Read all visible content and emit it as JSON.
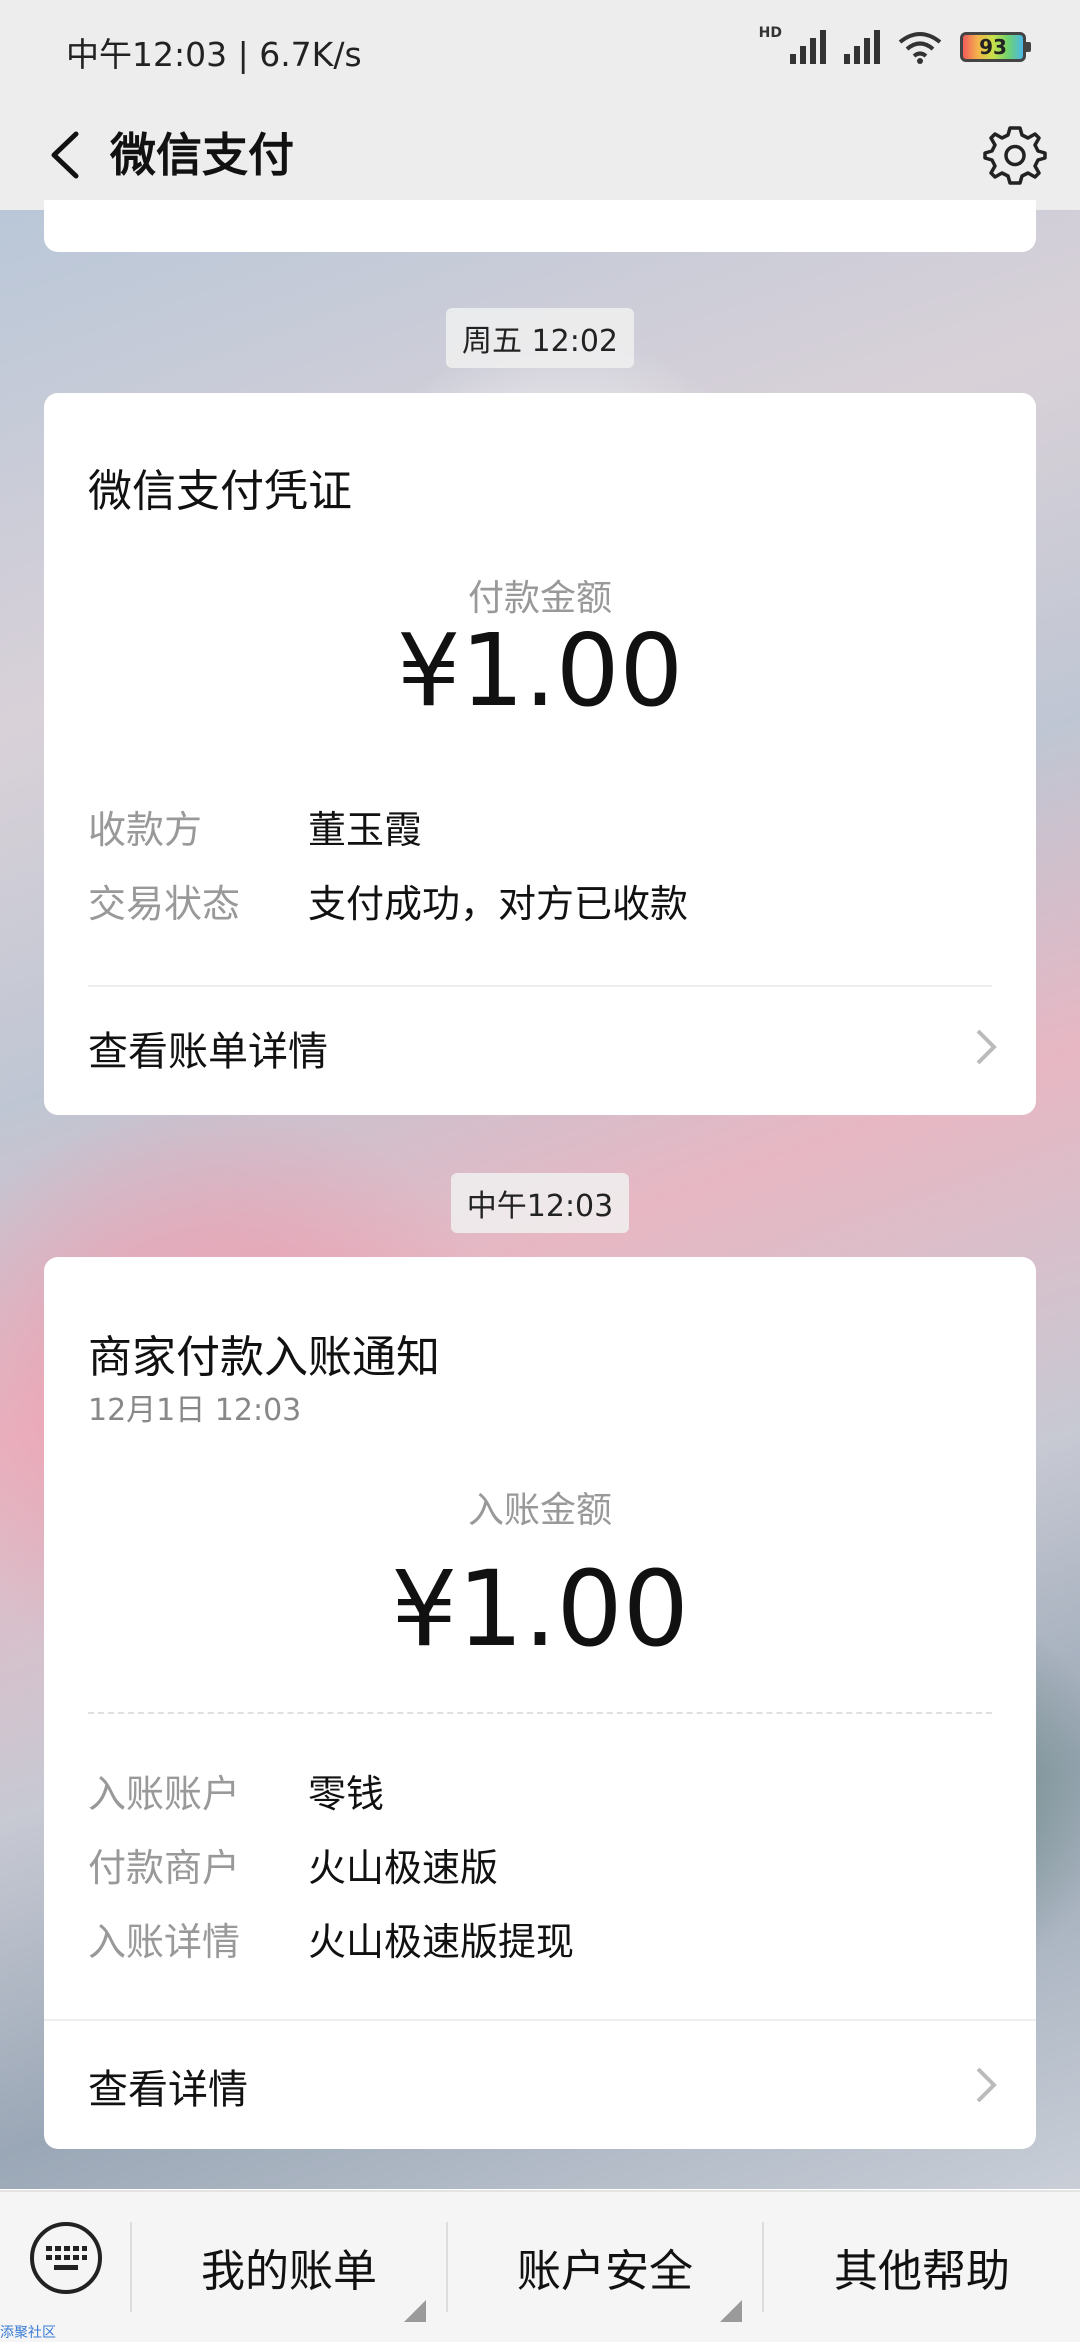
{
  "status_bar": {
    "time": "中午12:03 | 6.7K/s",
    "hd": "HD",
    "battery": "93"
  },
  "nav": {
    "title": "微信支付"
  },
  "cards": [
    {
      "timestamp": "周五 12:02",
      "title": "微信支付凭证",
      "amount_label": "付款金额",
      "amount": "¥1.00",
      "rows": [
        {
          "key": "收款方",
          "value": "董玉霞"
        },
        {
          "key": "交易状态",
          "value": "支付成功，对方已收款"
        }
      ],
      "link": "查看账单详情"
    },
    {
      "timestamp": "中午12:03",
      "title": "商家付款入账通知",
      "subtitle": "12月1日  12:03",
      "amount_label": "入账金额",
      "amount": "¥1.00",
      "rows": [
        {
          "key": "入账账户",
          "value": "零钱"
        },
        {
          "key": "付款商户",
          "value": "火山极速版"
        },
        {
          "key": "入账详情",
          "value": "火山极速版提现"
        }
      ],
      "link": "查看详情"
    }
  ],
  "bottom_menu": [
    "我的账单",
    "账户安全",
    "其他帮助"
  ],
  "watermark": "添聚社区",
  "colors": {
    "nav_bg": "#ededed",
    "card_bg": "#ffffff",
    "muted": "#999999"
  }
}
